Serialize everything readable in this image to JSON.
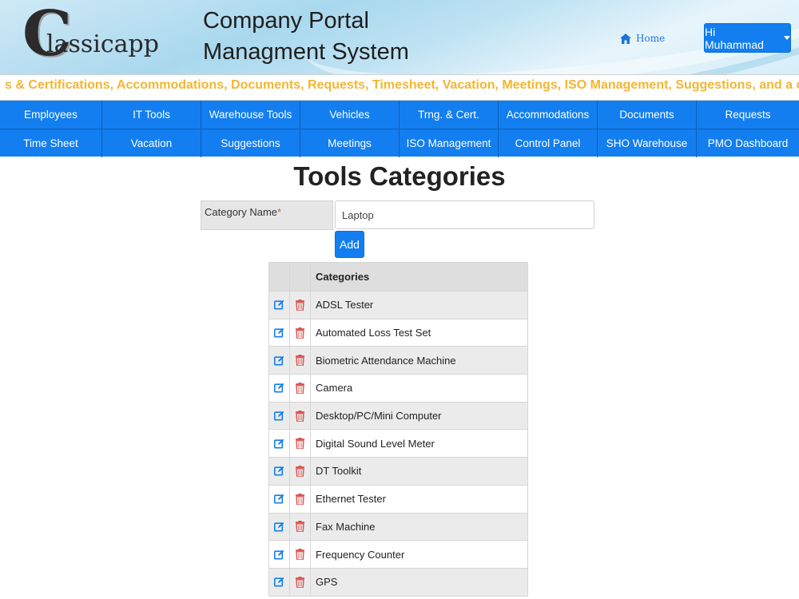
{
  "header": {
    "logo_big": "C",
    "logo_rest": "lassicapp",
    "title_line1": "Company Portal",
    "title_line2": "Managment System",
    "home_label": "Home",
    "user_label": "Hi Muhammad"
  },
  "marquee": {
    "text": "s & Certifications, Accommodations, Documents, Requests, Timesheet, Vacation, Meetings, ISO Management, Suggestions, and a centralized Control Pa"
  },
  "nav": {
    "row1": [
      "Employees",
      "IT Tools",
      "Warehouse Tools",
      "Vehicles",
      "Trng. & Cert.",
      "Accommodations",
      "Documents",
      "Requests"
    ],
    "row2": [
      "Time Sheet",
      "Vacation",
      "Suggestions",
      "Meetings",
      "ISO Management",
      "Control Panel",
      "SHO Warehouse",
      "PMO Dashboard"
    ]
  },
  "main": {
    "page_title": "Tools Categories",
    "category_label": "Category Name",
    "required_mark": "*",
    "category_value": "Laptop",
    "add_label": "Add",
    "table_header": "Categories",
    "rows": [
      "ADSL Tester",
      "Automated Loss Test Set",
      "Biometric Attendance Machine",
      "Camera",
      "Desktop/PC/Mini Computer",
      "Digital Sound Level Meter",
      "DT Toolkit",
      "Ethernet Tester",
      "Fax Machine",
      "Frequency Counter",
      "GPS"
    ]
  },
  "colors": {
    "primary": "#137ef0",
    "marquee_text": "#f2b632",
    "delete_icon": "#d9534f",
    "edit_icon": "#137ef0"
  },
  "icons": {
    "home": "home-icon",
    "edit": "edit-icon",
    "delete": "trash-icon",
    "caret": "chevron-down-icon"
  }
}
